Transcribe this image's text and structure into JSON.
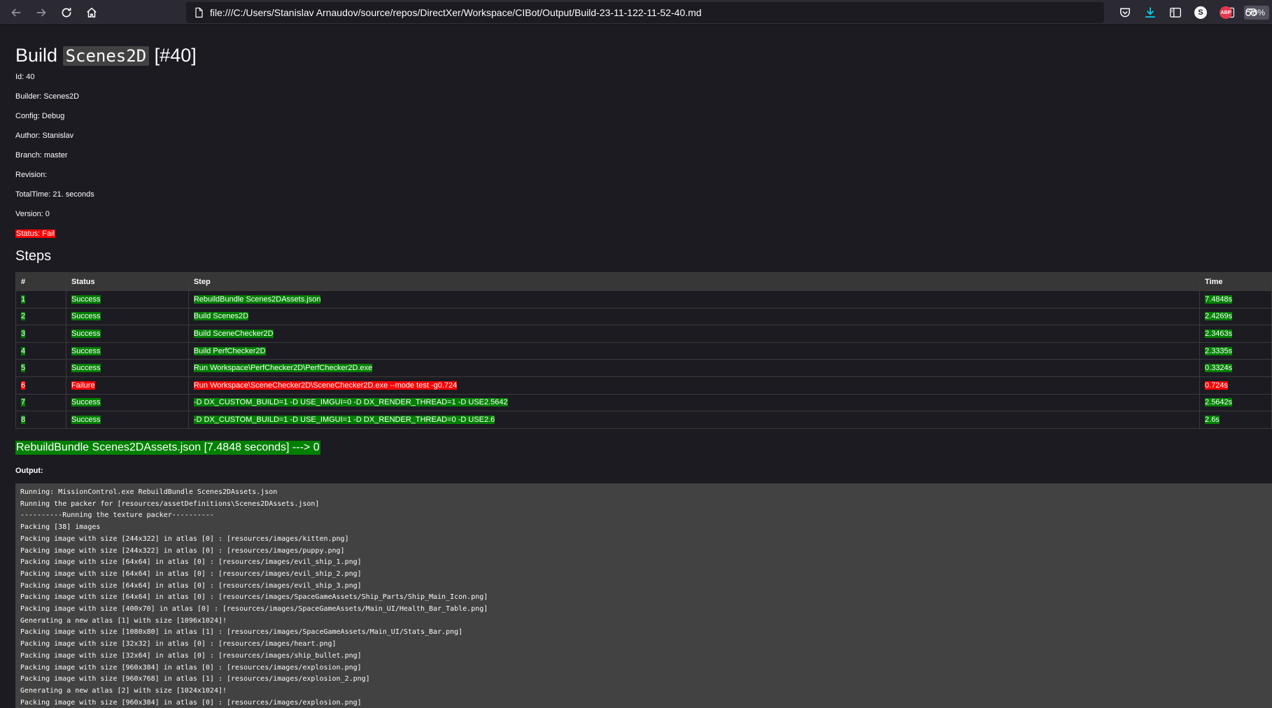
{
  "browser": {
    "url": "file:///C:/Users/Stanislav Arnaudov/source/repos/DirectXer/Workspace/CIBot/Output/Build-23-11-122-11-52-40.md",
    "zoom": "70%"
  },
  "build": {
    "title_prefix": "Build",
    "title_code": "Scenes2D",
    "title_suffix": "[#40]",
    "meta": [
      "Id: 40",
      "Builder: Scenes2D",
      "Config: Debug",
      "Author: Stanislav",
      "Branch: master",
      "Revision:",
      "TotalTime: 21. seconds",
      "Version: 0"
    ],
    "status": "Status: Fail"
  },
  "steps": {
    "heading": "Steps",
    "columns": [
      "#",
      "Status",
      "Step",
      "Time"
    ],
    "rows": [
      {
        "num": "1",
        "status": "Success",
        "step": "RebuildBundle Scenes2DAssets.json",
        "time": "7.4848s",
        "ok": true
      },
      {
        "num": "2",
        "status": "Success",
        "step": "Build Scenes2D",
        "time": "2.4269s",
        "ok": true
      },
      {
        "num": "3",
        "status": "Success",
        "step": "Build SceneChecker2D",
        "time": "2.3463s",
        "ok": true
      },
      {
        "num": "4",
        "status": "Success",
        "step": "Build PerfChecker2D",
        "time": "2.3335s",
        "ok": true
      },
      {
        "num": "5",
        "status": "Success",
        "step": "Run Workspace\\PerfChecker2D\\PerfChecker2D.exe",
        "time": "0.3324s",
        "ok": true
      },
      {
        "num": "6",
        "status": "Failure",
        "step": "Run Workspace\\SceneChecker2D\\SceneChecker2D.exe --mode test -g0.724",
        "time": "0.724s",
        "ok": false
      },
      {
        "num": "7",
        "status": "Success",
        "step": "-D DX_CUSTOM_BUILD=1 -D USE_IMGUI=0 -D DX_RENDER_THREAD=1 -D USE2.5642",
        "time": "2.5642s",
        "ok": true
      },
      {
        "num": "8",
        "status": "Success",
        "step": "-D DX_CUSTOM_BUILD=1 -D USE_IMGUI=1 -D DX_RENDER_THREAD=0 -D USE2.6",
        "time": "2.6s",
        "ok": true
      }
    ]
  },
  "section": {
    "title": "RebuildBundle Scenes2DAssets.json [7.4848 seconds] ---> 0",
    "output_label": "Output:",
    "lines": [
      "Running: MissionControl.exe RebuildBundle Scenes2DAssets.json",
      "Running the packer for [resources/assetDefinitions\\Scenes2DAssets.json]",
      "----------Running the texture packer----------",
      "Packing [38] images",
      "Packing image with size [244x322] in atlas [0] : [resources/images/kitten.png]",
      "Packing image with size [244x322] in atlas [0] : [resources/images/puppy.png]",
      "Packing image with size [64x64] in atlas [0] : [resources/images/evil_ship_1.png]",
      "Packing image with size [64x64] in atlas [0] : [resources/images/evil_ship_2.png]",
      "Packing image with size [64x64] in atlas [0] : [resources/images/evil_ship_3.png]",
      "Packing image with size [64x64] in atlas [0] : [resources/images/SpaceGameAssets/Ship_Parts/Ship_Main_Icon.png]",
      "Packing image with size [400x70] in atlas [0] : [resources/images/SpaceGameAssets/Main_UI/Health_Bar_Table.png]",
      "Generating a new atlas [1] with size [1096x1024]!",
      "Packing image with size [1080x80] in atlas [1] : [resources/images/SpaceGameAssets/Main_UI/Stats_Bar.png]",
      "Packing image with size [32x32] in atlas [0] : [resources/images/heart.png]",
      "Packing image with size [32x64] in atlas [0] : [resources/images/ship_bullet.png]",
      "Packing image with size [960x384] in atlas [0] : [resources/images/explosion.png]",
      "Packing image with size [960x768] in atlas [1] : [resources/images/explosion_2.png]",
      "Generating a new atlas [2] with size [1024x1024]!",
      "Packing image with size [960x384] in atlas [0] : [resources/images/explosion.png]"
    ]
  },
  "colors": {
    "success": "#008000",
    "failure": "#ff0000",
    "background": "#1c1b22",
    "code_background": "#424242"
  },
  "icons": [
    "back-arrow-icon",
    "forward-arrow-icon",
    "reload-icon",
    "home-icon",
    "page-icon",
    "reader-view-icon",
    "bookmark-star-icon",
    "pocket-icon",
    "download-icon",
    "sidebar-icon",
    "account-icon",
    "adblock-icon",
    "mask-icon"
  ]
}
